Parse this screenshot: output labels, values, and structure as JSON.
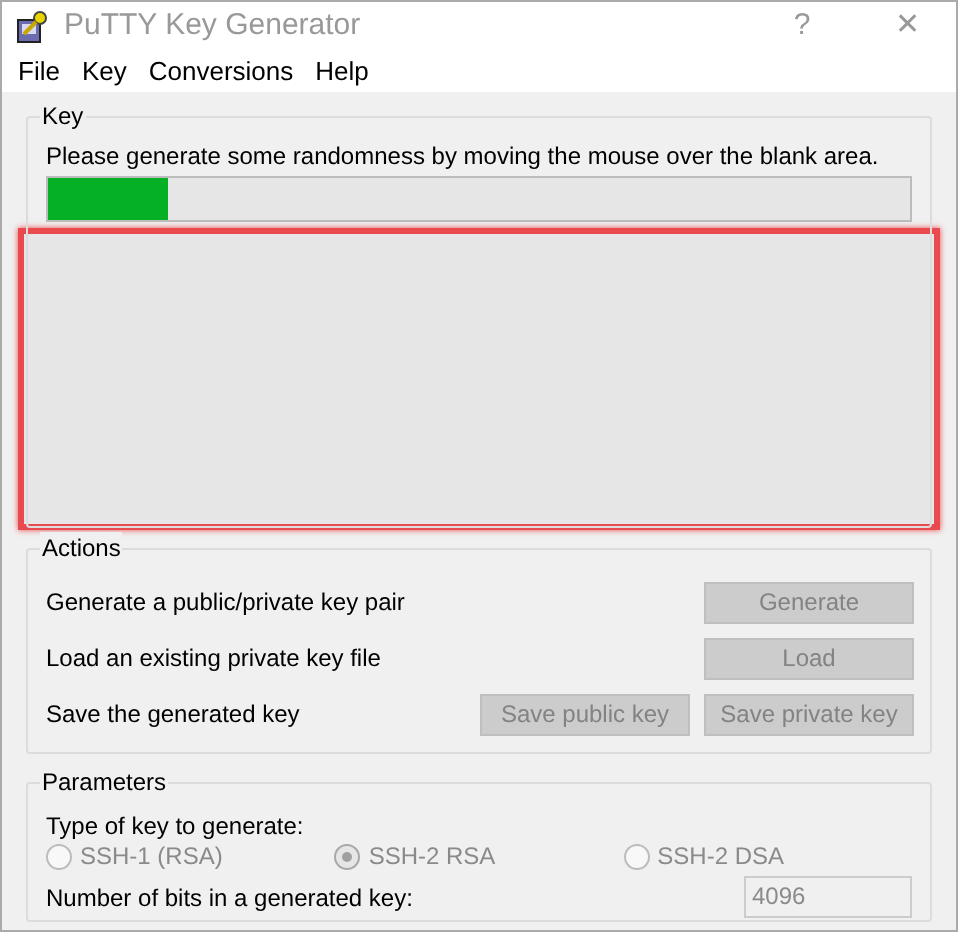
{
  "window": {
    "title": "PuTTY Key Generator",
    "help": "?",
    "close": "✕"
  },
  "menu": [
    "File",
    "Key",
    "Conversions",
    "Help"
  ],
  "key": {
    "title": "Key",
    "message": "Please generate some randomness by moving the mouse over the blank area.",
    "progress": {
      "level": 0.14
    },
    "blank_area": {
      "highlighted": true
    }
  },
  "actions": {
    "title": "Actions",
    "rows": [
      {
        "label": "Generate a public/private key pair",
        "buttons": [
          {
            "label": "Generate",
            "disabled": true
          }
        ]
      },
      {
        "label": "Load an existing private key file",
        "buttons": [
          {
            "label": "Load",
            "disabled": true
          }
        ]
      },
      {
        "label": "Save the generated key",
        "buttons": [
          {
            "label": "Save public key",
            "disabled": true
          },
          {
            "label": "Save private key",
            "disabled": true
          }
        ]
      }
    ]
  },
  "parameters": {
    "title": "Parameters",
    "type_label": "Type of key to generate:",
    "key_types": [
      {
        "label": "SSH-1 (RSA)",
        "selected": false,
        "disabled": true
      },
      {
        "label": "SSH-2 RSA",
        "selected": true,
        "disabled": true
      },
      {
        "label": "SSH-2 DSA",
        "selected": false,
        "disabled": true
      }
    ],
    "bits_label": "Number of bits in a generated key:",
    "bits": {
      "value": "4096",
      "disabled": true
    }
  }
}
